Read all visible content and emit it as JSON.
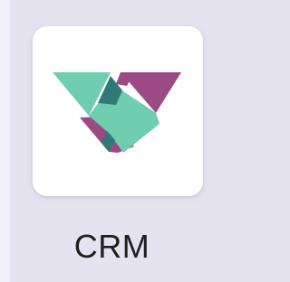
{
  "app": {
    "label": "CRM",
    "icon": "handshake-icon",
    "colors": {
      "purple": "#9b4a86",
      "teal": "#6fcdb0",
      "dark_teal": "#2f7a78",
      "card": "#ffffff",
      "background": "#e6e3f0"
    }
  }
}
